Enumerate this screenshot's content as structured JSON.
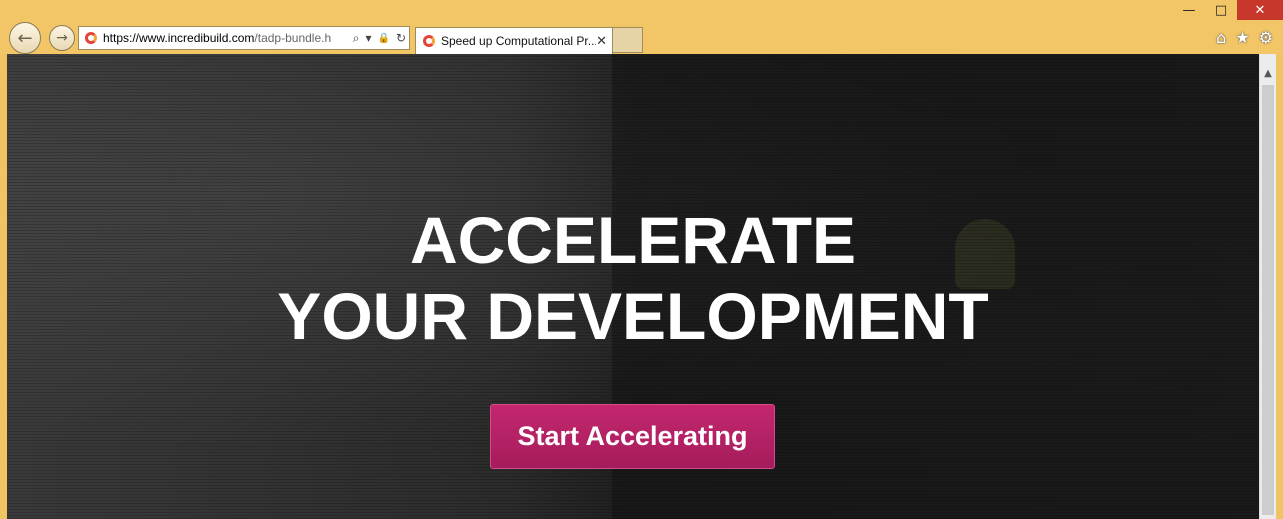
{
  "window": {
    "minimize": "—",
    "maximize": "□",
    "close": "✕"
  },
  "nav": {
    "back_icon": "←",
    "forward_icon": "→"
  },
  "address_bar": {
    "url_host": "https://www.incredibuild.com",
    "url_rest": "/tadp-bundle.h",
    "search_icon": "⌕",
    "dropdown_icon": "▾",
    "lock_icon": "🔒",
    "refresh_icon": "↻"
  },
  "tab": {
    "title": "Speed up Computational Pr...",
    "close": "✕"
  },
  "toolbar": {
    "home_icon": "⌂",
    "favorites_icon": "★",
    "settings_icon": "⚙"
  },
  "hero": {
    "line1": "ACCELERATE",
    "line2": "YOUR DEVELOPMENT",
    "cta": "Start Accelerating"
  },
  "scrollbar": {
    "up_arrow": "▲"
  },
  "colors": {
    "chrome": "#f2c666",
    "cta": "#b5215f",
    "close_button": "#c7372b"
  }
}
